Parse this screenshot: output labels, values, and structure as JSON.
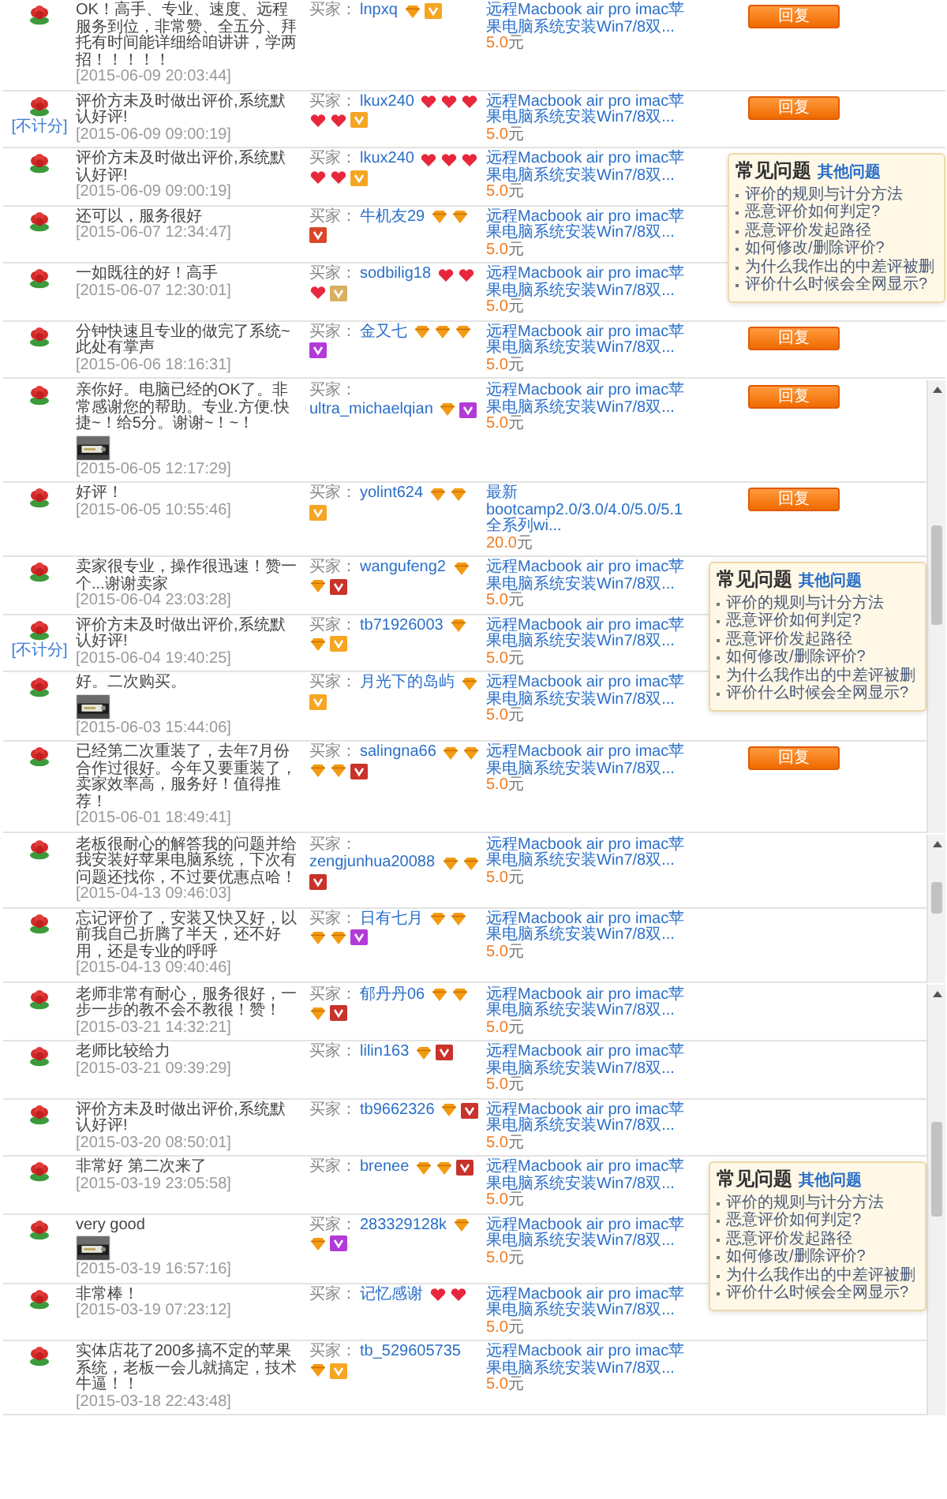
{
  "sections": [
    {
      "kind": "plain",
      "rows": [
        {
          "comment": "OK！高手、专业、速度、远程服务到位，非常赞、全五分、拜托有时间能详细给咱讲讲，学两招！！！！！",
          "date": "[2015-06-09 20:03:44]",
          "buyer_label": "买家：",
          "buyer": "lnpxq",
          "rank_icons": [
            {
              "kind": "diamond"
            }
          ],
          "badge": {
            "color": "#f5a623"
          },
          "product": "远程Macbook air pro imac苹果电脑系统安装Win7/8双...",
          "price": "5.0",
          "unit": "元",
          "reply": "回复"
        },
        {
          "note": "[不计分]",
          "comment": "评价方未及时做出评价,系统默认好评!",
          "date": "[2015-06-09 09:00:19]",
          "buyer_label": "买家：",
          "buyer": "lkux240",
          "rank_icons": [
            {
              "kind": "heart"
            },
            {
              "kind": "heart"
            },
            {
              "kind": "heart"
            },
            {
              "kind": "heart"
            },
            {
              "kind": "heart"
            }
          ],
          "badge": {
            "color": "#f5a623"
          },
          "product": "远程Macbook air pro imac苹果电脑系统安装Win7/8双...",
          "price": "5.0",
          "unit": "元",
          "reply": "回复"
        },
        {
          "comment": "评价方未及时做出评价,系统默认好评!",
          "date": "[2015-06-09 09:00:19]",
          "buyer_label": "买家：",
          "buyer": "lkux240",
          "rank_icons": [
            {
              "kind": "heart"
            },
            {
              "kind": "heart"
            },
            {
              "kind": "heart"
            },
            {
              "kind": "heart"
            },
            {
              "kind": "heart"
            }
          ],
          "badge": {
            "color": "#f5a623"
          },
          "product": "远程Macbook air pro imac苹果电脑系统安装Win7/8双...",
          "price": "5.0",
          "unit": "元",
          "faq": {
            "title": "常见问题",
            "link": "其他问题",
            "items": [
              "评价的规则与计分方法",
              "恶意评价如何判定?",
              "恶意评价发起路径",
              "如何修改/删除评价?",
              "为什么我作出的中差评被删",
              "评价什么时候会全网显示?"
            ]
          }
        },
        {
          "comment": "还可以，服务很好",
          "date": "[2015-06-07 12:34:47]",
          "buyer_label": "买家：",
          "buyer": "牛机友29",
          "rank_icons": [
            {
              "kind": "diamond"
            },
            {
              "kind": "diamond"
            }
          ],
          "badge": {
            "color": "#d9472b"
          },
          "product": "远程Macbook air pro imac苹果电脑系统安装Win7/8双...",
          "price": "5.0",
          "unit": "元"
        },
        {
          "comment": "一如既往的好！高手",
          "date": "[2015-06-07 12:30:01]",
          "buyer_label": "买家：",
          "buyer": "sodbilig18",
          "rank_icons": [
            {
              "kind": "heart"
            },
            {
              "kind": "heart"
            },
            {
              "kind": "heart"
            }
          ],
          "badge": {
            "color": "#d8b060"
          },
          "product": "远程Macbook air pro imac苹果电脑系统安装Win7/8双...",
          "price": "5.0",
          "unit": "元"
        },
        {
          "comment": "分钟快速且专业的做完了系统~此处有掌声",
          "date": "[2015-06-06 18:16:31]",
          "buyer_label": "买家：",
          "buyer": "金又七",
          "rank_icons": [
            {
              "kind": "diamond"
            },
            {
              "kind": "diamond"
            },
            {
              "kind": "diamond"
            }
          ],
          "badge": {
            "color": "#b23ad8"
          },
          "product": "远程Macbook air pro imac苹果电脑系统安装Win7/8双...",
          "price": "5.0",
          "unit": "元",
          "reply": "回复"
        }
      ]
    },
    {
      "kind": "scrolling",
      "rows": [
        {
          "comment": "亲你好。电脑已经的OK了。非常感谢您的帮助。专业.方便.快捷~！给5分。谢谢~！~！",
          "photo": {
            "kind": "picture"
          },
          "date": "[2015-06-05 12:17:29]",
          "buyer_label": "买家：",
          "buyer": "ultra_michaelqian",
          "rank_icons": [
            {
              "kind": "diamond"
            }
          ],
          "badge": {
            "color": "#b23ad8"
          },
          "product": "远程Macbook air pro imac苹果电脑系统安装Win7/8双...",
          "price": "5.0",
          "unit": "元",
          "reply": "回复"
        },
        {
          "comment": "好评！",
          "date": "[2015-06-05 10:55:46]",
          "buyer_label": "买家：",
          "buyer": "yolint624",
          "rank_icons": [
            {
              "kind": "diamond"
            },
            {
              "kind": "diamond"
            }
          ],
          "badge": {
            "color": "#f5a623"
          },
          "product": "最新bootcamp2.0/3.0/4.0/5.0/5.1全系列wi...",
          "price": "20.0",
          "unit": "元",
          "reply": "回复"
        },
        {
          "comment": "卖家很专业，操作很迅速！赞一个...谢谢卖家",
          "date": "[2015-06-04 23:03:28]",
          "buyer_label": "买家：",
          "buyer": "wangufeng2",
          "rank_icons": [
            {
              "kind": "diamond"
            },
            {
              "kind": "diamond"
            }
          ],
          "badge": {
            "color": "#c8332a"
          },
          "product": "远程Macbook air pro imac苹果电脑系统安装Win7/8双...",
          "price": "5.0",
          "unit": "元",
          "faq": {
            "title": "常见问题",
            "link": "其他问题",
            "items": [
              "评价的规则与计分方法",
              "恶意评价如何判定?",
              "恶意评价发起路径",
              "如何修改/删除评价?",
              "为什么我作出的中差评被删",
              "评价什么时候会全网显示?"
            ]
          }
        },
        {
          "note": "[不计分]",
          "comment": "评价方未及时做出评价,系统默认好评!",
          "date": "[2015-06-04 19:40:25]",
          "buyer_label": "买家：",
          "buyer": "tb71926003",
          "rank_icons": [
            {
              "kind": "diamond"
            },
            {
              "kind": "diamond"
            }
          ],
          "badge": {
            "color": "#f5a623"
          },
          "product": "远程Macbook air pro imac苹果电脑系统安装Win7/8双...",
          "price": "5.0",
          "unit": "元"
        },
        {
          "comment": "好。二次购买。",
          "photo": {
            "kind": "picture"
          },
          "date": "[2015-06-03 15:44:06]",
          "buyer_label": "买家：",
          "buyer": "月光下的岛屿",
          "rank_icons": [
            {
              "kind": "diamond"
            }
          ],
          "badge": {
            "color": "#f5a623"
          },
          "product": "远程Macbook air pro imac苹果电脑系统安装Win7/8双...",
          "price": "5.0",
          "unit": "元"
        },
        {
          "comment": "已经第二次重装了，去年7月份合作过很好。今年又要重装了，卖家效率高，服务好！值得推荐！",
          "date": "[2015-06-01 18:49:41]",
          "buyer_label": "买家：",
          "buyer": "salingna66",
          "rank_icons": [
            {
              "kind": "diamond"
            },
            {
              "kind": "diamond"
            },
            {
              "kind": "diamond"
            },
            {
              "kind": "diamond"
            }
          ],
          "badge": {
            "color": "#c8332a"
          },
          "product": "远程Macbook air pro imac苹果电脑系统安装Win7/8双...",
          "price": "5.0",
          "unit": "元",
          "reply": "回复"
        }
      ]
    },
    {
      "kind": "scrolling",
      "rows": [
        {
          "comment": "老板很耐心的解答我的问题并给我安装好苹果电脑系统，下次有问题还找你，不过要优惠点哈！",
          "date": "[2015-04-13 09:46:03]",
          "buyer_label": "买家：",
          "buyer": "zengjunhua20088",
          "rank_icons": [
            {
              "kind": "diamond"
            },
            {
              "kind": "diamond"
            }
          ],
          "badge": {
            "color": "#c8332a"
          },
          "product": "远程Macbook air pro imac苹果电脑系统安装Win7/8双...",
          "price": "5.0",
          "unit": "元"
        },
        {
          "comment": "忘记评价了，安装又快又好，以前我自己折腾了半天，还不好用，还是专业的呼呼",
          "date": "[2015-04-13 09:40:46]",
          "buyer_label": "买家：",
          "buyer": "日有七月",
          "rank_icons": [
            {
              "kind": "diamond"
            },
            {
              "kind": "diamond"
            },
            {
              "kind": "diamond"
            },
            {
              "kind": "diamond"
            }
          ],
          "badge": {
            "color": "#b23ad8"
          },
          "product": "远程Macbook air pro imac苹果电脑系统安装Win7/8双...",
          "price": "5.0",
          "unit": "元"
        }
      ]
    },
    {
      "kind": "scrolling",
      "rows": [
        {
          "comment": "老师非常有耐心，服务很好，一步一步的教不会不教很！赞！",
          "date": "[2015-03-21 14:32:21]",
          "buyer_label": "买家：",
          "buyer": "郁丹丹06",
          "rank_icons": [
            {
              "kind": "diamond"
            },
            {
              "kind": "diamond"
            },
            {
              "kind": "diamond"
            }
          ],
          "badge": {
            "color": "#c8332a"
          },
          "product": "远程Macbook air pro imac苹果电脑系统安装Win7/8双...",
          "price": "5.0",
          "unit": "元"
        },
        {
          "comment": "老师比较给力",
          "date": "[2015-03-21 09:39:29]",
          "buyer_label": "买家：",
          "buyer": "lilin163",
          "rank_icons": [
            {
              "kind": "diamond"
            }
          ],
          "badge": {
            "color": "#c8332a"
          },
          "product": "远程Macbook air pro imac苹果电脑系统安装Win7/8双...",
          "price": "5.0",
          "unit": "元"
        },
        {
          "comment": "评价方未及时做出评价,系统默认好评!",
          "date": "[2015-03-20 08:50:01]",
          "buyer_label": "买家：",
          "buyer": "tb9662326",
          "rank_icons": [
            {
              "kind": "diamond"
            }
          ],
          "badge": {
            "color": "#c8332a"
          },
          "product": "远程Macbook air pro imac苹果电脑系统安装Win7/8双...",
          "price": "5.0",
          "unit": "元"
        },
        {
          "comment": "非常好 第二次来了",
          "date": "[2015-03-19 23:05:58]",
          "buyer_label": "买家：",
          "buyer": "brenee",
          "rank_icons": [
            {
              "kind": "diamond"
            },
            {
              "kind": "diamond"
            }
          ],
          "badge": {
            "color": "#c8332a"
          },
          "product": "远程Macbook air pro imac苹果电脑系统安装Win7/8双...",
          "price": "5.0",
          "unit": "元",
          "faq": {
            "title": "常见问题",
            "link": "其他问题",
            "items": [
              "评价的规则与计分方法",
              "恶意评价如何判定?",
              "恶意评价发起路径",
              "如何修改/删除评价?",
              "为什么我作出的中差评被删",
              "评价什么时候会全网显示?"
            ]
          }
        },
        {
          "comment": "very good",
          "photo": {
            "kind": "picture"
          },
          "date": "[2015-03-19 16:57:16]",
          "buyer_label": "买家：",
          "buyer": "283329128k",
          "rank_icons": [
            {
              "kind": "diamond"
            },
            {
              "kind": "diamond"
            }
          ],
          "badge": {
            "color": "#b23ad8"
          },
          "product": "远程Macbook air pro imac苹果电脑系统安装Win7/8双...",
          "price": "5.0",
          "unit": "元"
        },
        {
          "comment": "非常棒！",
          "date": "[2015-03-19 07:23:12]",
          "buyer_label": "买家：",
          "buyer": "记忆感谢",
          "rank_icons": [
            {
              "kind": "heart"
            },
            {
              "kind": "heart"
            }
          ],
          "product": "远程Macbook air pro imac苹果电脑系统安装Win7/8双...",
          "price": "5.0",
          "unit": "元"
        },
        {
          "comment": "实体店花了200多搞不定的苹果系统，老板一会儿就搞定，技术牛逼！！",
          "date": "[2015-03-18 22:43:48]",
          "buyer_label": "买家：",
          "buyer": "tb_529605735",
          "rank_icons": [
            {
              "kind": "diamond"
            }
          ],
          "badge": {
            "color": "#f5a623"
          },
          "product": "远程Macbook air pro imac苹果电脑系统安装Win7/8双...",
          "price": "5.0",
          "unit": "元"
        }
      ]
    }
  ]
}
